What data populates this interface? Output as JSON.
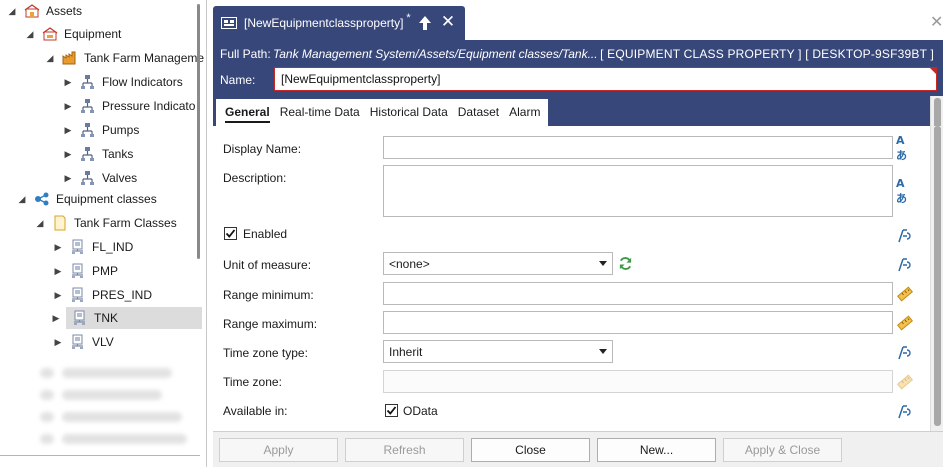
{
  "tree": {
    "items": [
      {
        "label": "Assets",
        "icon": "assets-icon",
        "expanded": true
      },
      {
        "label": "Equipment",
        "icon": "equipment-icon",
        "expanded": true
      },
      {
        "label": "Tank Farm Manageme",
        "icon": "plant-icon",
        "expanded": true
      },
      {
        "label": "Flow Indicators",
        "icon": "equipment-node-icon",
        "expanded": false
      },
      {
        "label": "Pressure Indicato",
        "icon": "equipment-node-icon",
        "expanded": false
      },
      {
        "label": "Pumps",
        "icon": "equipment-node-icon",
        "expanded": false
      },
      {
        "label": "Tanks",
        "icon": "equipment-node-icon",
        "expanded": false
      },
      {
        "label": "Valves",
        "icon": "equipment-node-icon",
        "expanded": false
      },
      {
        "label": "Equipment classes",
        "icon": "equipment-classes-icon",
        "expanded": true
      },
      {
        "label": "Tank Farm Classes",
        "icon": "folder-icon",
        "expanded": true
      },
      {
        "label": "FL_IND",
        "icon": "class-icon",
        "expanded": false
      },
      {
        "label": "PMP",
        "icon": "class-icon",
        "expanded": false
      },
      {
        "label": "PRES_IND",
        "icon": "class-icon",
        "expanded": false
      },
      {
        "label": "TNK",
        "icon": "class-icon",
        "expanded": false,
        "selected": true
      },
      {
        "label": "VLV",
        "icon": "class-icon",
        "expanded": false
      }
    ]
  },
  "tab": {
    "title": "[NewEquipmentclassproperty]",
    "modified_marker": "*"
  },
  "header": {
    "full_path_label": "Full Path:",
    "full_path_value": "Tank Management System/Assets/Equipment classes/Tank...",
    "meta": "[ EQUIPMENT CLASS PROPERTY ] [ DESKTOP-9SF39BT ]",
    "name_label": "Name:",
    "name_value": "[NewEquipmentclassproperty]"
  },
  "subtabs": [
    {
      "label": "General",
      "active": true
    },
    {
      "label": "Real-time Data",
      "active": false
    },
    {
      "label": "Historical Data",
      "active": false
    },
    {
      "label": "Dataset",
      "active": false
    },
    {
      "label": "Alarm",
      "active": false
    }
  ],
  "form": {
    "display_name_label": "Display Name:",
    "display_name_value": "",
    "description_label": "Description:",
    "description_value": "",
    "enabled_label": "Enabled",
    "enabled_checked": true,
    "unit_label": "Unit of measure:",
    "unit_value": "<none>",
    "range_min_label": "Range minimum:",
    "range_min_value": "",
    "range_max_label": "Range maximum:",
    "range_max_value": "",
    "tz_type_label": "Time zone type:",
    "tz_type_value": "Inherit",
    "tz_label": "Time zone:",
    "tz_value": "",
    "available_label": "Available in:",
    "odata_label": "OData",
    "odata_checked": true,
    "translate_icon_text": "Aあ"
  },
  "footer": {
    "apply": "Apply",
    "refresh": "Refresh",
    "close": "Close",
    "new": "New...",
    "apply_close": "Apply & Close"
  },
  "colors": {
    "header_bg": "#38477a",
    "error_border": "#c62828",
    "accent_blue": "#2c6aa8",
    "key_icon": "#e0a020"
  }
}
